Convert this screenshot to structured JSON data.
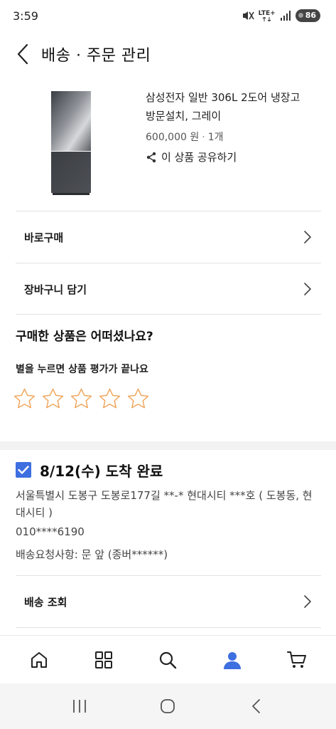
{
  "status_bar": {
    "time": "3:59",
    "network": "LTE+",
    "battery": "86"
  },
  "header": {
    "title": "배송 · 주문 관리",
    "back_icon": "chevron-left-icon"
  },
  "product": {
    "name_line1": "삼성전자 일반 306L 2도어 냉장고",
    "name_line2": "방문설치, 그레이",
    "price": "600,000 원",
    "quantity": "1개",
    "share_label": "이 상품 공유하기",
    "share_icon": "share-icon"
  },
  "actions": {
    "buy_now": "바로구매",
    "add_to_cart": "장바구니 담기"
  },
  "review": {
    "title": "구매한 상품은 어떠셨나요?",
    "subtitle": "별을 누르면 상품 평가가 끝나요",
    "rating": 0,
    "max_rating": 5,
    "star_color": "#f0a55a"
  },
  "delivery": {
    "status": "8/12(수) 도착 완료",
    "checked": true,
    "address": "서울특별시 도봉구 도봉로177길 **-* 현대시티 ***호 ( 도봉동, 현대시티 )",
    "phone": "010****6190",
    "request": "배송요청사항:  문 앞 (종버******)",
    "track_label": "배송 조회",
    "accent_color": "#3d6fe0"
  },
  "bottom_nav": {
    "items": [
      "home-icon",
      "grid-icon",
      "search-icon",
      "profile-icon",
      "cart-icon"
    ],
    "active": "profile-icon",
    "active_color": "#3d6fe0"
  },
  "system_nav": {
    "items": [
      "recents-icon",
      "home-circle-icon",
      "back-icon"
    ]
  }
}
